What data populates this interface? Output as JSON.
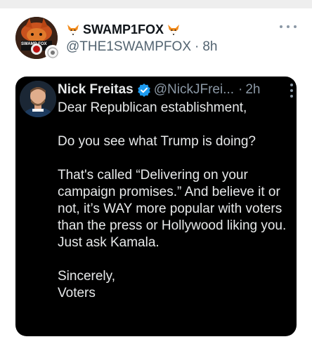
{
  "post": {
    "display_name": "SWAMP1FOX",
    "handle": "@THE1SWAMPFOX",
    "separator": "·",
    "time": "8h",
    "avatar_text": "SWAMP FOX"
  },
  "quoted_tweet": {
    "display_name": "Nick Freitas",
    "handle": "@NickJFrei...",
    "separator": "·",
    "time": "2h",
    "paragraphs": [
      "Dear Republican establishment,",
      "Do you see what Trump is doing?",
      "That's called “Delivering on your campaign promises.” And believe it or not, it’s WAY more popular with voters than the press or Hollywood liking you. Just ask Kamala.",
      "Sincerely,\nVoters"
    ]
  },
  "colors": {
    "card_background": "#000000",
    "verified_blue": "#1d9bf0",
    "handle_gray": "#536471"
  },
  "icons": [
    "fox-icon",
    "more-icon",
    "verified-icon"
  ]
}
